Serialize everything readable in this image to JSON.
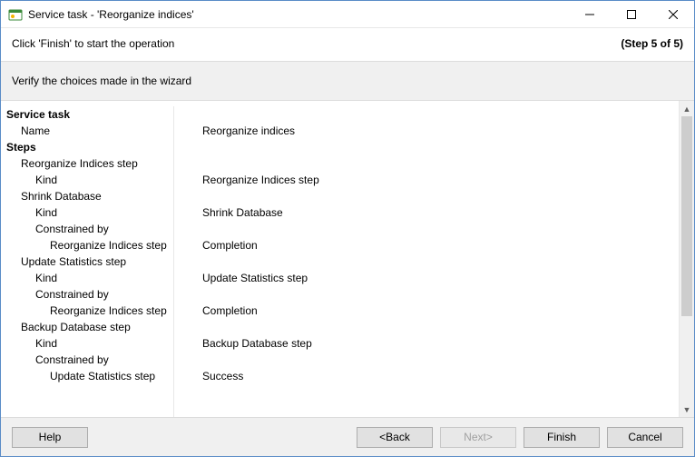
{
  "window": {
    "title": "Service task - 'Reorganize indices'"
  },
  "header": {
    "instruction": "Click 'Finish' to start the operation",
    "step": "(Step 5 of 5)"
  },
  "banner": {
    "text": "Verify the choices made in the wizard"
  },
  "summary": {
    "service_task_heading": "Service task",
    "name_label": "Name",
    "name_value": "Reorganize indices",
    "steps_heading": "Steps",
    "step1": {
      "title": "Reorganize Indices step",
      "kind_label": "Kind",
      "kind_value": "Reorganize Indices step"
    },
    "step2": {
      "title": "Shrink Database",
      "kind_label": "Kind",
      "kind_value": "Shrink Database",
      "constrained_label": "Constrained by",
      "constrained_step": "Reorganize Indices step",
      "constrained_value": "Completion"
    },
    "step3": {
      "title": "Update Statistics step",
      "kind_label": "Kind",
      "kind_value": "Update Statistics step",
      "constrained_label": "Constrained by",
      "constrained_step": "Reorganize Indices step",
      "constrained_value": "Completion"
    },
    "step4": {
      "title": "Backup Database step",
      "kind_label": "Kind",
      "kind_value": "Backup Database step",
      "constrained_label": "Constrained by",
      "constrained_step": "Update Statistics step",
      "constrained_value": "Success"
    }
  },
  "footer": {
    "help": "Help",
    "back": "<Back",
    "next": "Next>",
    "finish": "Finish",
    "cancel": "Cancel"
  }
}
